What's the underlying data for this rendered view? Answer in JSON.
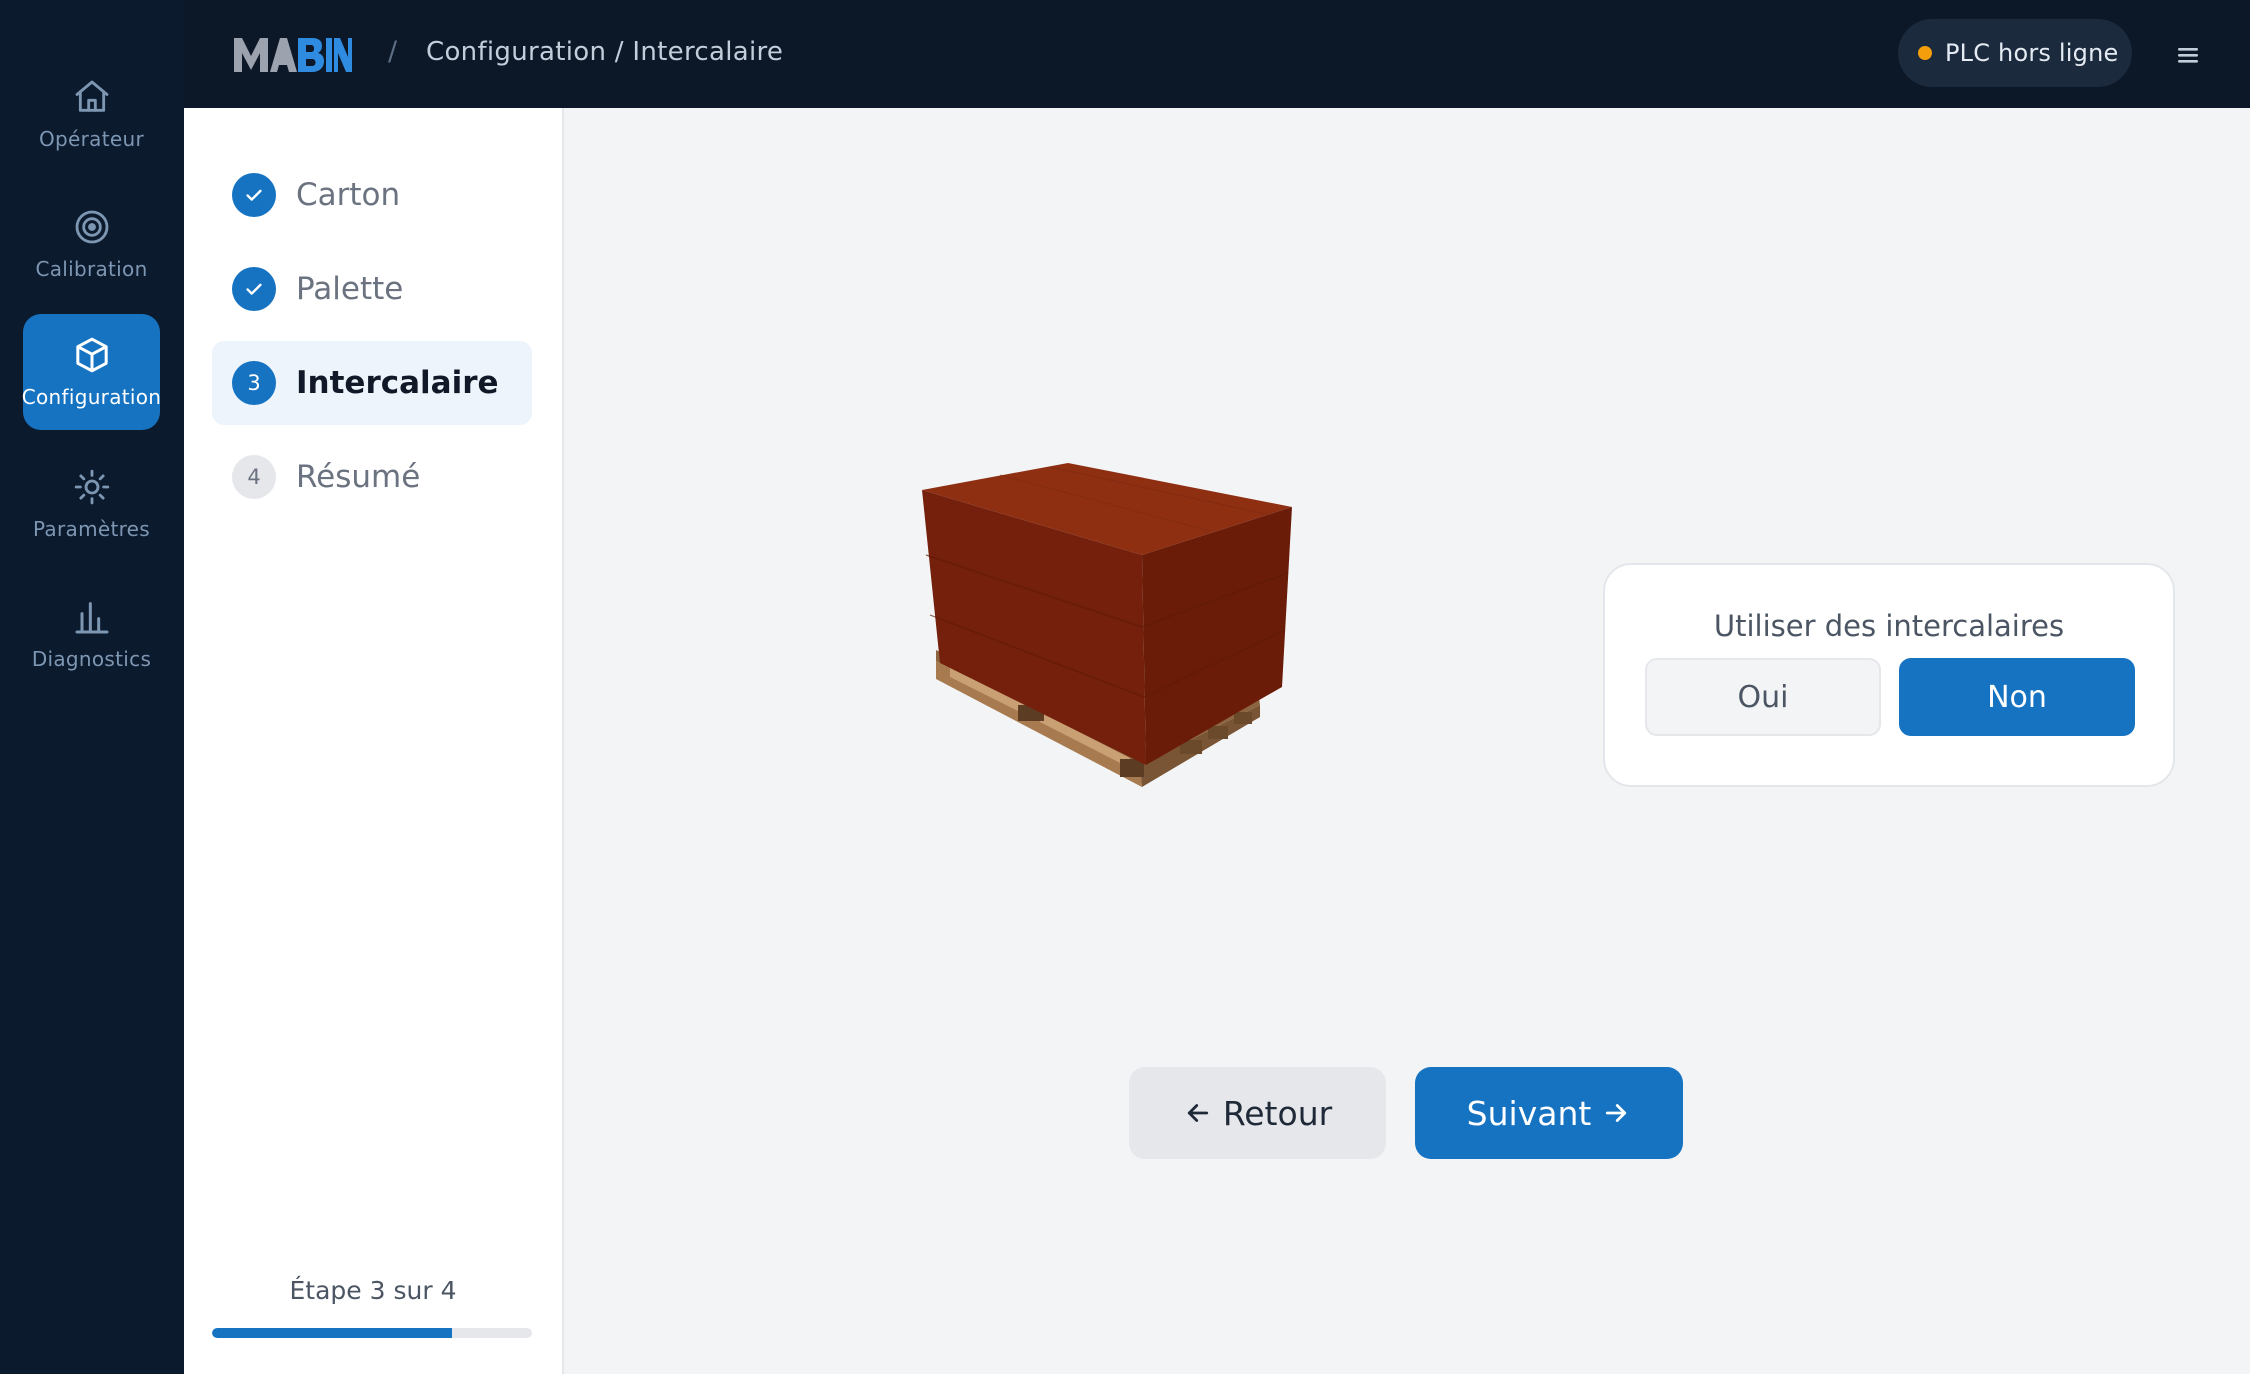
{
  "nav": {
    "items": [
      {
        "label": "Opérateur",
        "icon": "home-icon",
        "active": false
      },
      {
        "label": "Calibration",
        "icon": "target-icon",
        "active": false
      },
      {
        "label": "Configuration",
        "icon": "cube-icon",
        "active": true
      },
      {
        "label": "Paramètres",
        "icon": "sun-icon",
        "active": false
      },
      {
        "label": "Diagnostics",
        "icon": "bar-chart-icon",
        "active": false
      }
    ]
  },
  "header": {
    "logo": "MABIN",
    "separator": "/",
    "breadcrumb": "Configuration / Intercalaire",
    "plc_status": "PLC hors ligne",
    "plc_status_color": "#f59e0b"
  },
  "steps": {
    "items": [
      {
        "number": "1",
        "label": "Carton",
        "state": "done"
      },
      {
        "number": "2",
        "label": "Palette",
        "state": "done"
      },
      {
        "number": "3",
        "label": "Intercalaire",
        "state": "current"
      },
      {
        "number": "4",
        "label": "Résumé",
        "state": "todo"
      }
    ],
    "progress_text": "Étape 3 sur 4",
    "progress_fraction": 0.75
  },
  "intercalaire": {
    "title": "Utiliser des intercalaires",
    "option_yes": "Oui",
    "option_no": "Non",
    "selected": "Non"
  },
  "actions": {
    "back_label": "Retour",
    "next_label": "Suivant"
  },
  "colors": {
    "accent": "#1573c2",
    "sidebar_bg": "#0c1a2e",
    "box_color": "#7a2410",
    "pallet_wood": "#b78a5a"
  }
}
